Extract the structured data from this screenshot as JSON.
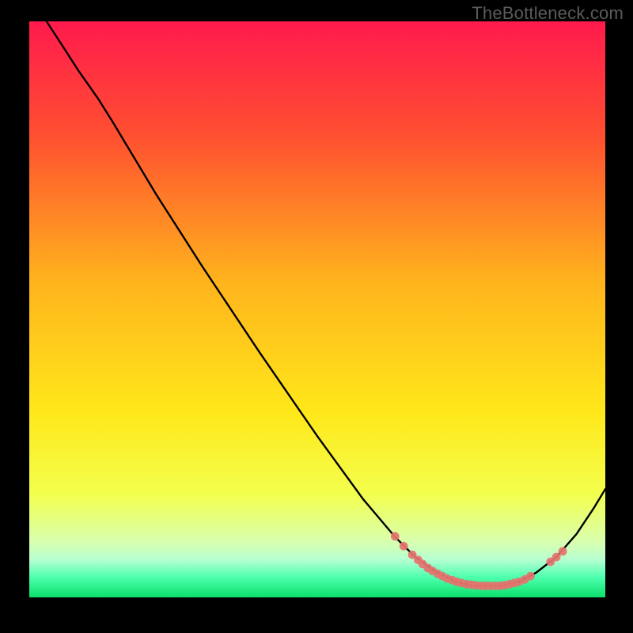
{
  "watermark": "TheBottleneck.com",
  "chart_data": {
    "type": "line",
    "title": "",
    "xlabel": "",
    "ylabel": "",
    "xlim": [
      0,
      100
    ],
    "ylim": [
      0,
      100
    ],
    "grid": false,
    "gradient_stops": [
      {
        "offset": 0.0,
        "color": "#ff1a4d"
      },
      {
        "offset": 0.2,
        "color": "#ff5030"
      },
      {
        "offset": 0.45,
        "color": "#ffb31d"
      },
      {
        "offset": 0.68,
        "color": "#ffe81a"
      },
      {
        "offset": 0.82,
        "color": "#f3ff4d"
      },
      {
        "offset": 0.905,
        "color": "#d8ffb0"
      },
      {
        "offset": 0.935,
        "color": "#b5ffd2"
      },
      {
        "offset": 0.965,
        "color": "#4dffad"
      },
      {
        "offset": 1.0,
        "color": "#0be06c"
      }
    ],
    "curve": [
      {
        "x": 3.0,
        "y": 100.0
      },
      {
        "x": 5.6,
        "y": 96.0
      },
      {
        "x": 8.5,
        "y": 91.5
      },
      {
        "x": 12.0,
        "y": 86.5
      },
      {
        "x": 14.5,
        "y": 82.5
      },
      {
        "x": 22.0,
        "y": 70.0
      },
      {
        "x": 30.0,
        "y": 57.5
      },
      {
        "x": 40.0,
        "y": 42.5
      },
      {
        "x": 50.0,
        "y": 28.0
      },
      {
        "x": 58.0,
        "y": 17.0
      },
      {
        "x": 63.5,
        "y": 10.5
      },
      {
        "x": 67.0,
        "y": 7.0
      },
      {
        "x": 70.5,
        "y": 4.5
      },
      {
        "x": 74.0,
        "y": 2.7
      },
      {
        "x": 77.5,
        "y": 2.0
      },
      {
        "x": 81.5,
        "y": 2.0
      },
      {
        "x": 85.0,
        "y": 2.7
      },
      {
        "x": 88.0,
        "y": 4.3
      },
      {
        "x": 91.5,
        "y": 7.0
      },
      {
        "x": 95.0,
        "y": 11.0
      },
      {
        "x": 98.0,
        "y": 15.5
      },
      {
        "x": 100.0,
        "y": 18.8
      }
    ],
    "markers": [
      {
        "x": 63.5,
        "y": 10.6
      },
      {
        "x": 65.0,
        "y": 8.9
      },
      {
        "x": 66.5,
        "y": 7.4
      },
      {
        "x": 67.5,
        "y": 6.5
      },
      {
        "x": 68.3,
        "y": 5.8
      },
      {
        "x": 69.2,
        "y": 5.1
      },
      {
        "x": 70.0,
        "y": 4.6
      },
      {
        "x": 70.9,
        "y": 4.1
      },
      {
        "x": 71.7,
        "y": 3.7
      },
      {
        "x": 72.5,
        "y": 3.3
      },
      {
        "x": 73.4,
        "y": 3.0
      },
      {
        "x": 74.2,
        "y": 2.7
      },
      {
        "x": 75.0,
        "y": 2.5
      },
      {
        "x": 75.9,
        "y": 2.3
      },
      {
        "x": 76.7,
        "y": 2.2
      },
      {
        "x": 77.5,
        "y": 2.1
      },
      {
        "x": 78.4,
        "y": 2.0
      },
      {
        "x": 79.2,
        "y": 2.0
      },
      {
        "x": 80.0,
        "y": 2.0
      },
      {
        "x": 80.9,
        "y": 2.0
      },
      {
        "x": 81.7,
        "y": 2.0
      },
      {
        "x": 82.5,
        "y": 2.1
      },
      {
        "x": 83.4,
        "y": 2.3
      },
      {
        "x": 84.2,
        "y": 2.5
      },
      {
        "x": 85.0,
        "y": 2.7
      },
      {
        "x": 86.0,
        "y": 3.1
      },
      {
        "x": 87.0,
        "y": 3.7
      },
      {
        "x": 90.5,
        "y": 6.2
      },
      {
        "x": 91.5,
        "y": 7.0
      },
      {
        "x": 92.6,
        "y": 8.0
      }
    ]
  }
}
